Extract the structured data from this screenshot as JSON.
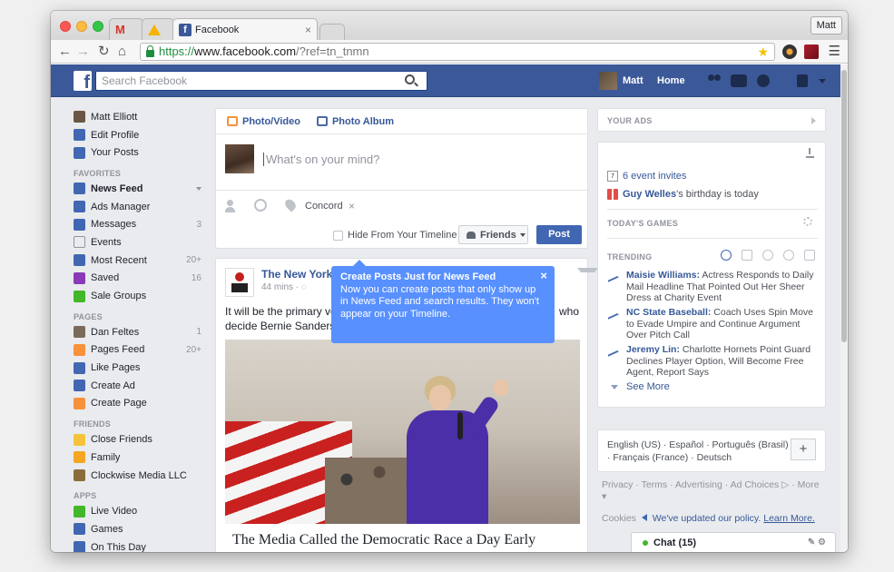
{
  "browser": {
    "tabs": [
      {
        "label": "M"
      },
      {
        "label": ""
      },
      {
        "label": "Facebook",
        "close": "×"
      }
    ],
    "profile": "Matt",
    "url_scheme": "https://",
    "url_host": "www.facebook.com",
    "url_path": "/?ref=tn_tnmn"
  },
  "fbbar": {
    "search_placeholder": "Search Facebook",
    "user": "Matt",
    "home": "Home"
  },
  "leftnav": {
    "profile": [
      {
        "label": "Matt Elliott",
        "icon": "avatar-icon",
        "color": "#6b5645"
      },
      {
        "label": "Edit Profile",
        "icon": "edit-icon",
        "color": "#4267b2"
      },
      {
        "label": "Your Posts",
        "icon": "person-icon",
        "color": "#4267b2"
      }
    ],
    "favorites_head": "FAVORITES",
    "favorites": [
      {
        "label": "News Feed",
        "icon": "news-feed-icon",
        "color": "#4267b2",
        "bold": true,
        "chev": true
      },
      {
        "label": "Ads Manager",
        "icon": "chart-icon",
        "color": "#4267b2"
      },
      {
        "label": "Messages",
        "icon": "messages-icon",
        "color": "#4267b2",
        "count": "3"
      },
      {
        "label": "Events",
        "icon": "calendar-icon",
        "color": "#e9ebee"
      },
      {
        "label": "Most Recent",
        "icon": "news-feed-icon",
        "color": "#4267b2",
        "count": "20+"
      },
      {
        "label": "Saved",
        "icon": "bookmark-icon",
        "color": "#8a3ab9",
        "count": "16"
      },
      {
        "label": "Sale Groups",
        "icon": "tag-icon",
        "color": "#42b72a"
      }
    ],
    "pages_head": "PAGES",
    "pages": [
      {
        "label": "Dan Feltes",
        "icon": "page-icon",
        "color": "#7a6a5a",
        "count": "1"
      },
      {
        "label": "Pages Feed",
        "icon": "flag-icon",
        "color": "#f7923a",
        "count": "20+"
      },
      {
        "label": "Like Pages",
        "icon": "like-icon",
        "color": "#4267b2"
      },
      {
        "label": "Create Ad",
        "icon": "chart-icon",
        "color": "#4267b2"
      },
      {
        "label": "Create Page",
        "icon": "flag-plus-icon",
        "color": "#f7923a"
      }
    ],
    "friends_head": "FRIENDS",
    "friends": [
      {
        "label": "Close Friends",
        "icon": "star-icon",
        "color": "#f5c33b"
      },
      {
        "label": "Family",
        "icon": "house-icon",
        "color": "#f5a623"
      },
      {
        "label": "Clockwise Media LLC",
        "icon": "work-icon",
        "color": "#8a6d3b"
      }
    ],
    "apps_head": "APPS",
    "apps": [
      {
        "label": "Live Video",
        "icon": "video-icon",
        "color": "#42b72a"
      },
      {
        "label": "Games",
        "icon": "games-icon",
        "color": "#4267b2"
      },
      {
        "label": "On This Day",
        "icon": "clock-icon",
        "color": "#4267b2"
      }
    ]
  },
  "composer": {
    "tab_photo": "Photo/Video",
    "tab_album": "Photo Album",
    "placeholder": "What's on your mind?",
    "location": "Concord",
    "location_close": "×",
    "hide_label": "Hide From Your Timeline",
    "audience": "Friends",
    "post": "Post"
  },
  "tooltip": {
    "title": "Create Posts Just for News Feed",
    "body": "Now you can create posts that only show up in News Feed and search results. They won't appear on your Timeline.",
    "close": "×"
  },
  "story": {
    "source": "The New York",
    "time": "44 mins · ",
    "text_line1": "It will be the primary vo",
    "text_who": "who",
    "text_line2": "decide Bernie Sanders",
    "headline": "The Media Called the Democratic Race a Day Early"
  },
  "rightrail": {
    "your_ads": "YOUR ADS",
    "event_invites": "6 event invites",
    "birthday_name": "Guy Welles",
    "birthday_rest": "'s birthday is today",
    "games_head": "TODAY'S GAMES",
    "trending_head": "TRENDING",
    "trends": [
      {
        "title": "Maisie Williams:",
        "text": " Actress Responds to Daily Mail Headline That Pointed Out Her Sheer Dress at Charity Event"
      },
      {
        "title": "NC State Baseball:",
        "text": " Coach Uses Spin Move to Evade Umpire and Continue Argument Over Pitch Call"
      },
      {
        "title": "Jeremy Lin:",
        "text": " Charlotte Hornets Point Guard Declines Player Option, Will Become Free Agent, Report Says"
      }
    ],
    "see_more": "See More",
    "languages": "English (US) · Español · Português (Brasil) · Français (France) · Deutsch",
    "plus": "+",
    "footer": "Privacy · Terms · Advertising · Ad Choices ▷ · More ▾",
    "cookies_label": "Cookies",
    "cookies_link": "We've updated our policy.",
    "learn_more": "Learn More."
  },
  "chat": {
    "label": "Chat (15)"
  }
}
